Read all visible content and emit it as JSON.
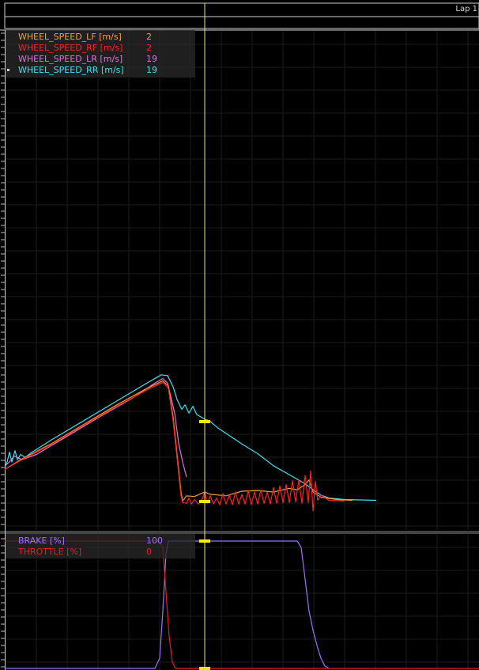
{
  "header": {
    "lap_label": "Lap 1"
  },
  "colors": {
    "background": "#000000",
    "grid": "#1c1c1c",
    "frame": "#d0d0d0",
    "cursor": "#e8e890",
    "cursor_marker": "#f5ea00",
    "legend_bg": "#282828"
  },
  "chart_data": [
    {
      "type": "line",
      "x_unit": "s",
      "xlim": [
        0,
        60
      ],
      "ylim": [
        0,
        40
      ],
      "cursor_x": 25.3,
      "grid": true,
      "legend_placement": "top-left",
      "legend": [
        {
          "name": "WHEEL_SPEED_LF [m/s]",
          "value": "2",
          "color": "#f0a030"
        },
        {
          "name": "WHEEL_SPEED_RF [m/s]",
          "value": "2",
          "color": "#ff2020"
        },
        {
          "name": "WHEEL_SPEED_LR [m/s]",
          "value": "19",
          "color": "#e070e0"
        },
        {
          "name": "WHEEL_SPEED_RR [m/s]",
          "value": "19",
          "color": "#40e0f0",
          "selected": true
        }
      ],
      "series": [
        {
          "name": "WHEEL_SPEED_LR [m/s]",
          "color": "#e070e0",
          "points": [
            [
              0,
              5.5
            ],
            [
              0.6,
              6.0
            ],
            [
              1.2,
              6.8
            ],
            [
              2.2,
              6.3
            ],
            [
              4.0,
              7.0
            ],
            [
              8.0,
              9.5
            ],
            [
              12.0,
              12.0
            ],
            [
              16.0,
              14.4
            ],
            [
              19.0,
              16.5
            ],
            [
              20.0,
              17.1
            ],
            [
              20.6,
              16.5
            ],
            [
              21.5,
              12.5
            ],
            [
              22.0,
              8.5
            ],
            [
              22.5,
              6.0
            ],
            [
              23.0,
              4.0
            ]
          ]
        },
        {
          "name": "WHEEL_SPEED_RR [m/s]",
          "color": "#40e0f0",
          "points": [
            [
              0,
              5.2
            ],
            [
              0.3,
              6.0
            ],
            [
              0.6,
              7.3
            ],
            [
              0.9,
              6.0
            ],
            [
              1.3,
              7.5
            ],
            [
              1.6,
              6.3
            ],
            [
              2.0,
              7.0
            ],
            [
              2.6,
              6.6
            ],
            [
              3.3,
              7.2
            ],
            [
              6.0,
              9.0
            ],
            [
              10.0,
              11.5
            ],
            [
              14.0,
              14.0
            ],
            [
              17.5,
              16.2
            ],
            [
              19.8,
              17.6
            ],
            [
              20.6,
              17.5
            ],
            [
              21.3,
              16.0
            ],
            [
              21.8,
              14.3
            ],
            [
              22.4,
              13.0
            ],
            [
              22.8,
              13.6
            ],
            [
              23.3,
              12.5
            ],
            [
              23.8,
              13.4
            ],
            [
              24.3,
              12.3
            ],
            [
              25.3,
              11.7
            ],
            [
              26.0,
              11.4
            ],
            [
              27.0,
              10.5
            ],
            [
              28.0,
              9.8
            ],
            [
              30.0,
              8.4
            ],
            [
              32.0,
              7.1
            ],
            [
              34.0,
              5.5
            ],
            [
              36.0,
              4.3
            ],
            [
              38.0,
              3.1
            ],
            [
              39.0,
              2.3
            ],
            [
              40.0,
              1.6
            ],
            [
              41.0,
              1.2
            ],
            [
              43.0,
              1.0
            ],
            [
              45.0,
              0.95
            ],
            [
              47.0,
              0.9
            ]
          ]
        },
        {
          "name": "WHEEL_SPEED_LF [m/s]",
          "color": "#f0a030",
          "points": [
            [
              0,
              5.0
            ],
            [
              2.0,
              6.3
            ],
            [
              6.0,
              8.5
            ],
            [
              10.0,
              11.0
            ],
            [
              14.0,
              13.5
            ],
            [
              18.0,
              15.8
            ],
            [
              20.0,
              16.8
            ],
            [
              20.7,
              16.1
            ],
            [
              21.3,
              12.0
            ],
            [
              21.8,
              7.0
            ],
            [
              22.3,
              2.0
            ],
            [
              22.5,
              0.8
            ],
            [
              23.0,
              1.5
            ],
            [
              24.0,
              1.4
            ],
            [
              25.3,
              2.0
            ],
            [
              26.0,
              1.7
            ],
            [
              28.0,
              1.5
            ],
            [
              30.0,
              2.1
            ],
            [
              32.0,
              2.2
            ],
            [
              34.0,
              2.0
            ],
            [
              36.0,
              2.5
            ],
            [
              37.0,
              2.3
            ],
            [
              38.0,
              3.0
            ],
            [
              38.5,
              3.6
            ],
            [
              39.0,
              2.0
            ],
            [
              40.0,
              1.3
            ],
            [
              42.0,
              1.0
            ],
            [
              44.0,
              0.9
            ]
          ]
        },
        {
          "name": "WHEEL_SPEED_RF [m/s]",
          "color": "#ff2020",
          "points": [
            [
              0,
              5.0
            ],
            [
              2.0,
              6.2
            ],
            [
              6.0,
              8.4
            ],
            [
              10.0,
              10.9
            ],
            [
              14.0,
              13.3
            ],
            [
              18.0,
              15.6
            ],
            [
              20.0,
              16.6
            ],
            [
              20.7,
              15.8
            ],
            [
              21.3,
              11.5
            ],
            [
              21.8,
              6.5
            ],
            [
              22.3,
              1.5
            ],
            [
              22.5,
              0.6
            ],
            [
              23.0,
              0.5
            ],
            [
              23.3,
              1.2
            ],
            [
              23.6,
              0.4
            ],
            [
              24.0,
              1.0
            ],
            [
              24.5,
              0.4
            ],
            [
              25.0,
              1.1
            ],
            [
              25.3,
              2.0
            ],
            [
              25.6,
              0.5
            ],
            [
              26.0,
              1.5
            ],
            [
              26.4,
              0.4
            ],
            [
              26.8,
              1.2
            ],
            [
              27.2,
              0.3
            ],
            [
              27.6,
              1.8
            ],
            [
              28.0,
              0.4
            ],
            [
              28.4,
              1.6
            ],
            [
              28.8,
              0.3
            ],
            [
              29.2,
              2.0
            ],
            [
              29.6,
              0.4
            ],
            [
              30.0,
              1.7
            ],
            [
              30.4,
              0.4
            ],
            [
              30.8,
              2.2
            ],
            [
              31.2,
              0.3
            ],
            [
              31.6,
              2.0
            ],
            [
              32.0,
              0.4
            ],
            [
              32.4,
              2.3
            ],
            [
              32.8,
              0.5
            ],
            [
              33.2,
              2.0
            ],
            [
              33.6,
              0.4
            ],
            [
              34.0,
              2.6
            ],
            [
              34.4,
              0.5
            ],
            [
              34.8,
              2.8
            ],
            [
              35.2,
              0.6
            ],
            [
              35.6,
              3.0
            ],
            [
              36.0,
              0.6
            ],
            [
              36.4,
              3.5
            ],
            [
              36.8,
              0.7
            ],
            [
              37.2,
              3.6
            ],
            [
              37.6,
              0.5
            ],
            [
              38.0,
              4.2
            ],
            [
              38.4,
              0.6
            ],
            [
              38.7,
              4.8
            ],
            [
              39.0,
              -0.5
            ],
            [
              39.3,
              3.4
            ],
            [
              39.6,
              0.9
            ],
            [
              40.0,
              1.6
            ],
            [
              41.0,
              0.9
            ],
            [
              43.0,
              0.8
            ]
          ]
        }
      ]
    },
    {
      "type": "line",
      "x_unit": "s",
      "xlim": [
        0,
        60
      ],
      "ylim": [
        0,
        100
      ],
      "cursor_x": 25.3,
      "grid": true,
      "legend_placement": "top-left",
      "legend": [
        {
          "name": "BRAKE [%]",
          "value": "100",
          "color": "#a070ff"
        },
        {
          "name": "THROTTLE [%]",
          "value": "0",
          "color": "#e02020"
        }
      ],
      "series": [
        {
          "name": "BRAKE [%]",
          "color": "#a070ff",
          "points": [
            [
              0,
              0
            ],
            [
              19.0,
              0
            ],
            [
              19.6,
              8
            ],
            [
              20.0,
              45
            ],
            [
              20.4,
              90
            ],
            [
              20.7,
              100
            ],
            [
              37.0,
              100
            ],
            [
              37.5,
              95
            ],
            [
              38.0,
              70
            ],
            [
              38.5,
              45
            ],
            [
              39.0,
              30
            ],
            [
              39.5,
              18
            ],
            [
              40.0,
              8
            ],
            [
              40.5,
              2
            ],
            [
              41.0,
              0
            ]
          ]
        },
        {
          "name": "THROTTLE [%]",
          "color": "#e02020",
          "points": [
            [
              0,
              100
            ],
            [
              19.5,
              100
            ],
            [
              20.0,
              95
            ],
            [
              20.4,
              60
            ],
            [
              20.8,
              25
            ],
            [
              21.2,
              5
            ],
            [
              21.6,
              0
            ],
            [
              60,
              0
            ]
          ]
        }
      ]
    }
  ]
}
